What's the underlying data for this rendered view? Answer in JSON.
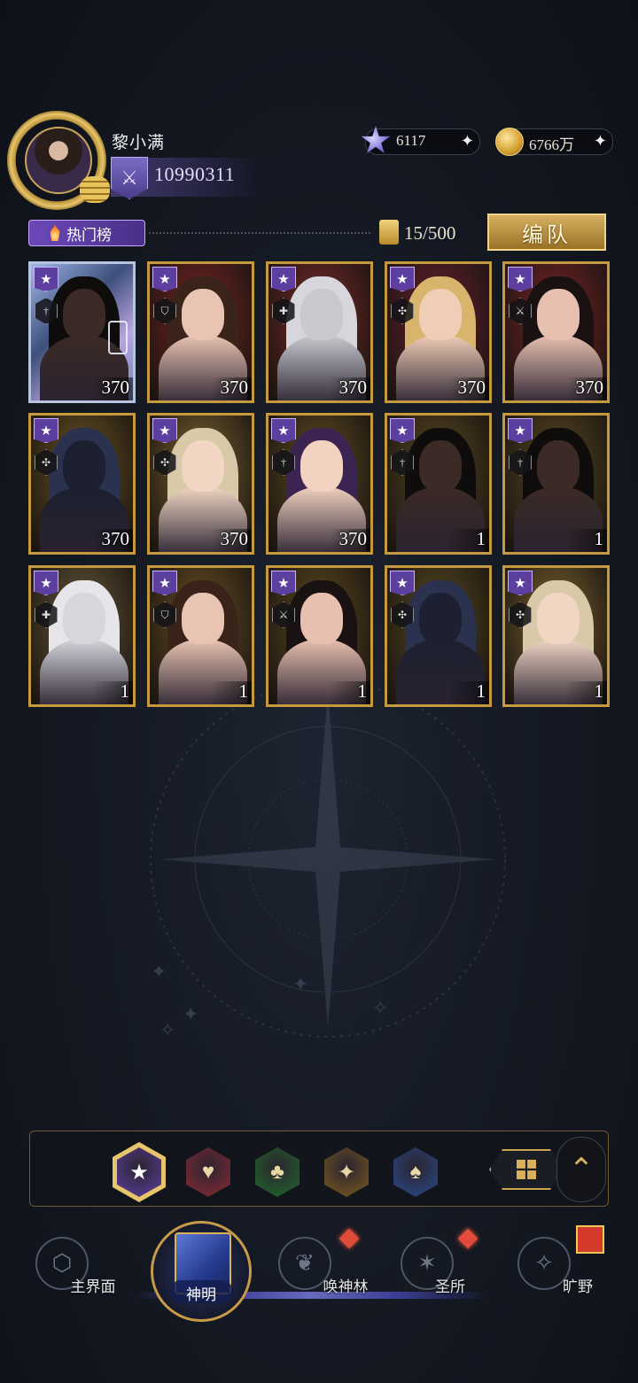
{
  "player": {
    "name": "黎小满",
    "power": "10990311"
  },
  "currencies": {
    "star": {
      "icon": "star-crystal-icon",
      "value": "6117"
    },
    "gold": {
      "icon": "gold-coin-icon",
      "value": "6766万"
    }
  },
  "toolbar": {
    "hot_label": "热门榜",
    "card_count": "15/500",
    "formation_label": "编队"
  },
  "cards": [
    {
      "level": "370",
      "frame": "rainbow",
      "class_icon": "sword-icon",
      "bg": "#3d4f7a",
      "skin": "#3b2a26",
      "hair": "#0f0c0c"
    },
    {
      "level": "370",
      "frame": "red",
      "class_icon": "shield-icon",
      "bg": "#7a2424",
      "skin": "#e9c4b2",
      "hair": "#3a241a"
    },
    {
      "level": "370",
      "frame": "red",
      "class_icon": "cross-icon",
      "bg": "#7a2a2a",
      "skin": "#c9c9cf",
      "hair": "#d6d6dc"
    },
    {
      "level": "370",
      "frame": "red",
      "class_icon": "shuriken-icon",
      "bg": "#6a2030",
      "skin": "#f0cdb6",
      "hair": "#d9b46c"
    },
    {
      "level": "370",
      "frame": "red",
      "class_icon": "crossed-swords-icon",
      "bg": "#7a2428",
      "skin": "#e8c0b0",
      "hair": "#1a1212"
    },
    {
      "level": "370",
      "frame": "gold",
      "class_icon": "shuriken-icon",
      "bg": "#6b5524",
      "skin": "#1c2030",
      "hair": "#2a3250"
    },
    {
      "level": "370",
      "frame": "gold",
      "class_icon": "shuriken-icon",
      "bg": "#7a6430",
      "skin": "#f1d6c4",
      "hair": "#d8c9a8"
    },
    {
      "level": "370",
      "frame": "gold",
      "class_icon": "sword-icon",
      "bg": "#5f4c22",
      "skin": "#f2d2c0",
      "hair": "#3c2452"
    },
    {
      "level": "1",
      "frame": "gold",
      "class_icon": "sword-icon",
      "bg": "#5a4822",
      "skin": "#3b2a26",
      "hair": "#0f0c0c"
    },
    {
      "level": "1",
      "frame": "gold",
      "class_icon": "sword-icon",
      "bg": "#5a4822",
      "skin": "#3b2a26",
      "hair": "#0f0c0c"
    },
    {
      "level": "1",
      "frame": "gold",
      "class_icon": "cross-icon",
      "bg": "#6a5a3a",
      "skin": "#d6d6dc",
      "hair": "#e6e6ea"
    },
    {
      "level": "1",
      "frame": "gold",
      "class_icon": "shield-icon",
      "bg": "#6a5224",
      "skin": "#e9c4b2",
      "hair": "#3a241a"
    },
    {
      "level": "1",
      "frame": "gold",
      "class_icon": "crossed-swords-icon",
      "bg": "#5f4a20",
      "skin": "#e8c0b0",
      "hair": "#1a1212"
    },
    {
      "level": "1",
      "frame": "gold",
      "class_icon": "shuriken-icon",
      "bg": "#5a4a22",
      "skin": "#1c2030",
      "hair": "#2a3250"
    },
    {
      "level": "1",
      "frame": "gold",
      "class_icon": "shuriken-icon",
      "bg": "#7a6430",
      "skin": "#f1d6c4",
      "hair": "#d8c9a8"
    }
  ],
  "filters": [
    {
      "name": "filter-star",
      "icon": "star-icon",
      "glyph": "★",
      "color": "#5d3fa0",
      "active": true
    },
    {
      "name": "filter-heart",
      "icon": "heart-icon",
      "glyph": "♥",
      "color": "#8a2a34",
      "active": false
    },
    {
      "name": "filter-club",
      "icon": "club-icon",
      "glyph": "♣",
      "color": "#1f6a2a",
      "active": false
    },
    {
      "name": "filter-sparkle",
      "icon": "sparkle-icon",
      "glyph": "✦",
      "color": "#7a5a1e",
      "active": false
    },
    {
      "name": "filter-spade",
      "icon": "spade-icon",
      "glyph": "♠",
      "color": "#2a4a8a",
      "active": false
    }
  ],
  "nav": [
    {
      "label": "主界面",
      "icon": "main-emblem-icon"
    },
    {
      "label": "神明",
      "icon": "card-book-icon"
    },
    {
      "label": "唤神林",
      "icon": "tree-icon"
    },
    {
      "label": "圣所",
      "icon": "sanctum-icon"
    },
    {
      "label": "旷野",
      "icon": "compass-icon"
    }
  ]
}
